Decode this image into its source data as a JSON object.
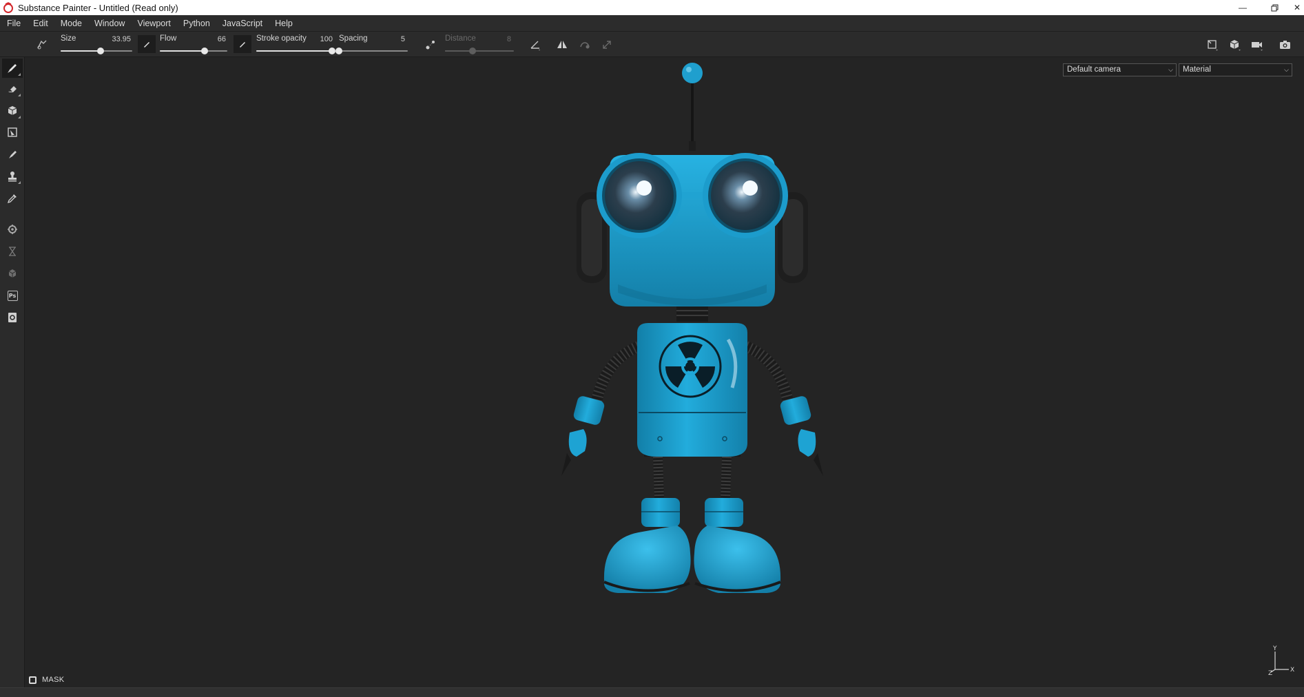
{
  "window": {
    "title": "Substance Painter - Untitled (Read only)",
    "controls": [
      "minimize-icon",
      "restore-icon",
      "close-icon"
    ]
  },
  "menu": {
    "items": [
      "File",
      "Edit",
      "Mode",
      "Window",
      "Viewport",
      "Python",
      "JavaScript",
      "Help"
    ]
  },
  "toolbar": {
    "size": {
      "label": "Size",
      "value": "33.95",
      "level": 0.56
    },
    "flow": {
      "label": "Flow",
      "value": "66",
      "level": 0.66
    },
    "stroke_opacity": {
      "label": "Stroke opacity",
      "value": "100",
      "level": 1.0
    },
    "spacing": {
      "label": "Spacing",
      "value": "5",
      "level": 0.0
    },
    "distance": {
      "label": "Distance",
      "value": "8",
      "level": 0.4,
      "disabled": true
    },
    "right_icons": [
      "2d-view-icon",
      "3d-view-icon",
      "camera-icon",
      "screenshot-icon"
    ]
  },
  "left_tools": [
    "paint-brush-icon",
    "eraser-icon",
    "projection-icon",
    "polygon-fill-icon",
    "smudge-icon",
    "clone-stamp-icon",
    "color-picker-icon",
    "bake-settings-icon",
    "export-icon",
    "iray-icon",
    "photoshop-icon",
    "sdk-doc-icon"
  ],
  "viewport": {
    "camera_select": "Default camera",
    "channel_select": "Material",
    "mask_label": "MASK",
    "axis_labels": {
      "y": "Y",
      "z": "Z",
      "x": "X"
    }
  },
  "colors": {
    "robot_blue": "#1aa3d4",
    "background": "#242424",
    "panel": "#2b2b2b"
  }
}
